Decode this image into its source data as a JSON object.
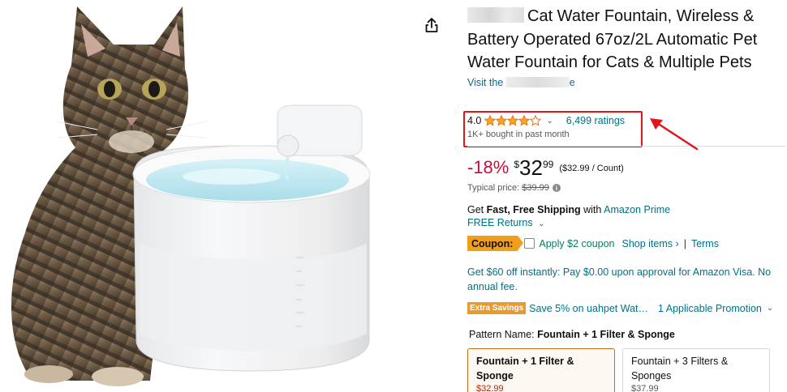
{
  "product": {
    "title": "Cat Water Fountain, Wireless & Battery Operated 67oz/2L Automatic Pet Water Fountain for Cats & Multiple Pets",
    "store_link_prefix": "Visit the",
    "store_link_suffix": "e"
  },
  "rating": {
    "value": "4.0",
    "stars_filled": 4,
    "stars_total": 5,
    "chevron": "⌄",
    "ratings_count": "6,499 ratings",
    "bought": "1K+ bought in past month"
  },
  "price": {
    "discount": "-18%",
    "currency": "$",
    "whole": "32",
    "fraction": "99",
    "unit_price": "($32.99 / Count)",
    "typical_label": "Typical price:",
    "typical_value": "$39.99"
  },
  "shipping": {
    "get": "Get",
    "fast_free": "Fast, Free Shipping",
    "with": "with",
    "prime": "Amazon Prime",
    "returns": "FREE Returns"
  },
  "coupon": {
    "badge": "Coupon:",
    "text": "Apply $2 coupon",
    "shop_items": "Shop items ›",
    "separator": "|",
    "terms": "Terms"
  },
  "visa": {
    "text": "Get $60 off instantly: Pay $0.00 upon approval for Amazon Visa. No annual fee."
  },
  "promotion": {
    "badge": "Extra Savings",
    "text": "Save 5% on uahpet Wat…",
    "link": "1 Applicable Promotion"
  },
  "pattern": {
    "label": "Pattern Name:",
    "selected": "Fountain + 1 Filter & Sponge",
    "options": [
      {
        "name": "Fountain + 1 Filter & Sponge",
        "price": "$32.99"
      },
      {
        "name": "Fountain + 3 Filters & Sponges",
        "price": "$37.99"
      }
    ]
  },
  "colors": {
    "link": "#007185",
    "discount": "#cc0c39",
    "annotation": "#e3141b",
    "coupon_badge": "#f19e18",
    "coupon_text": "#067d62"
  },
  "icons": {
    "share": "share-icon",
    "info": "info-icon",
    "star": "star-icon"
  }
}
